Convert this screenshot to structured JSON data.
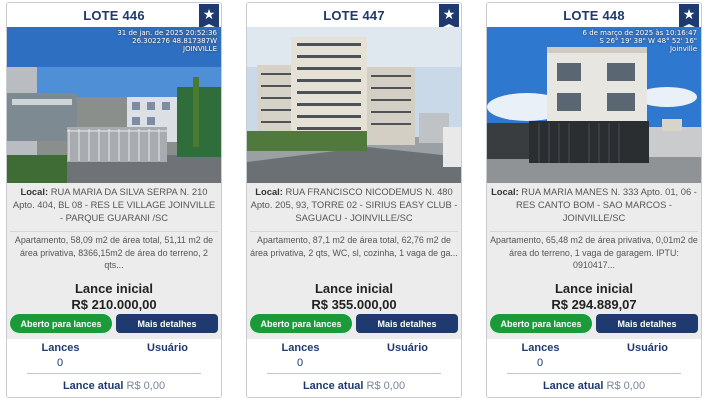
{
  "cards": [
    {
      "lote": "LOTE 446",
      "star_icon": "star-icon",
      "photo_stamp": [
        "31 de jan. de 2025 20:52:36",
        "26.302276 48.817387W",
        "JOINVILLE"
      ],
      "local_label": "Local:",
      "local_text": "RUA MARIA DA SILVA SERPA N. 210 Apto. 404, BL 08 - RES LE VILLAGE JOINVILLE - PARQUE GUARANI /SC",
      "description": "Apartamento, 58,09 m2 de área total, 51,11 m2 de área privativa, 8366,15m2 de área do terreno, 2 qts...",
      "lance_inicial_label": "Lance inicial",
      "lance_inicial_value": "R$ 210.000,00",
      "status_button": "Aberto para lances",
      "details_button": "Mais detalhes",
      "lances_label": "Lances",
      "usuario_label": "Usuário",
      "lances_count": "0",
      "usuario_value": "",
      "lance_atual_label": "Lance atual",
      "lance_atual_value": "R$ 0,00"
    },
    {
      "lote": "LOTE 447",
      "star_icon": "star-icon",
      "photo_stamp": [],
      "local_label": "Local:",
      "local_text": "RUA FRANCISCO NICODEMUS N. 480 Apto. 205, 93, TORRE 02 - SIRIUS EASY CLUB - SAGUACU - JOINVILLE/SC",
      "description": "Apartamento, 87,1 m2 de área total, 62,76 m2 de área privativa, 2 qts, WC, sl, cozinha, 1 vaga de ga...",
      "lance_inicial_label": "Lance inicial",
      "lance_inicial_value": "R$ 355.000,00",
      "status_button": "Aberto para lances",
      "details_button": "Mais detalhes",
      "lances_label": "Lances",
      "usuario_label": "Usuário",
      "lances_count": "0",
      "usuario_value": "",
      "lance_atual_label": "Lance atual",
      "lance_atual_value": "R$ 0,00"
    },
    {
      "lote": "LOTE 448",
      "star_icon": "star-icon",
      "photo_stamp": [
        "6 de março de 2025 às 10:16:47",
        "S 26° 19' 38\" W 48° 52' 16\"",
        "Joinville"
      ],
      "local_label": "Local:",
      "local_text": "RUA MARIA MANES N. 333 Apto. 01, 06 - RES CANTO BOM - SAO MARCOS - JOINVILLE/SC",
      "description": "Apartamento, 65,48 m2 de área privativa, 0,01m2 de área do terreno, 1 vaga de garagem. IPTU: 0910417...",
      "lance_inicial_label": "Lance inicial",
      "lance_inicial_value": "R$ 294.889,07",
      "status_button": "Aberto para lances",
      "details_button": "Mais detalhes",
      "lances_label": "Lances",
      "usuario_label": "Usuário",
      "lances_count": "0",
      "usuario_value": "",
      "lance_atual_label": "Lance atual",
      "lance_atual_value": "R$ 0,00"
    }
  ],
  "colors": {
    "brand_blue": "#1e3a6e",
    "open_green": "#1b9a3a"
  }
}
